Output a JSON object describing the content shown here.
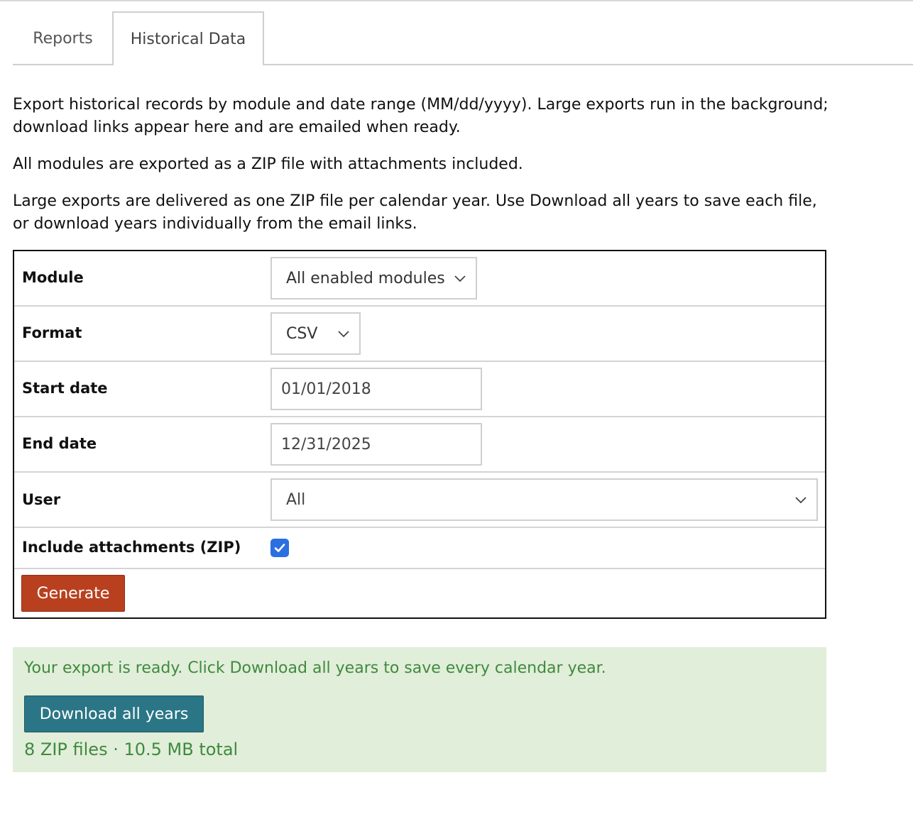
{
  "tabs": [
    {
      "label": "Reports",
      "active": false
    },
    {
      "label": "Historical Data",
      "active": true
    }
  ],
  "intro": {
    "p1": "Export historical records by module and date range (MM/dd/yyyy). Large exports run in the background; download links appear here and are emailed when ready.",
    "p2": "All modules are exported as a ZIP file with attachments included.",
    "p3": "Large exports are delivered as one ZIP file per calendar year. Use Download all years to save each file, or download years individually from the email links."
  },
  "form": {
    "module": {
      "label": "Module",
      "value": "All enabled modules"
    },
    "format": {
      "label": "Format",
      "value": "CSV"
    },
    "start_date": {
      "label": "Start date",
      "value": "01/01/2018"
    },
    "end_date": {
      "label": "End date",
      "value": "12/31/2025"
    },
    "user": {
      "label": "User",
      "value": "All"
    },
    "attachments": {
      "label": "Include attachments (ZIP)",
      "checked": true
    },
    "generate_label": "Generate"
  },
  "ready": {
    "message": "Your export is ready. Click Download all years to save every calendar year.",
    "download_label": "Download all years",
    "summary": "8 ZIP files · 10.5 MB total"
  },
  "colors": {
    "generate_button": "#b8401e",
    "download_button": "#2b7686",
    "success_bg": "#e1eed9",
    "success_text": "#3f8a3f",
    "checkbox": "#2b6fe0"
  }
}
